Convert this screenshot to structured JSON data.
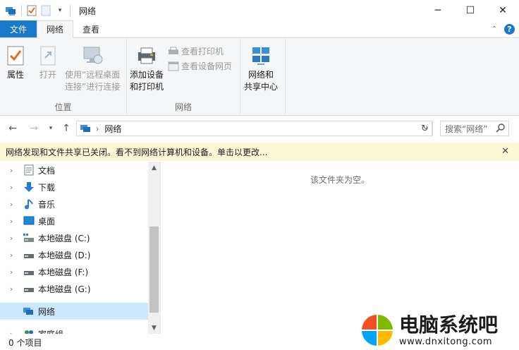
{
  "window": {
    "title": "网络",
    "minimize_icon": "─",
    "maximize_icon": "☐",
    "close_icon": "✕"
  },
  "ribbon_tabs": {
    "file": "文件",
    "network": "网络",
    "view": "查看"
  },
  "ribbon": {
    "location_group": {
      "label": "位置",
      "properties": "属性",
      "open": "打开",
      "remote_desktop_line1": "使用“远程桌面",
      "remote_desktop_line2": "连接”进行连接"
    },
    "network_group": {
      "label": "网络",
      "add_devices_line1": "添加设备",
      "add_devices_line2": "和打印机",
      "view_printers": "查看打印机",
      "view_device_webpage": "查看设备网页"
    },
    "sharing_group": {
      "network_sharing_line1": "网络和",
      "network_sharing_line2": "共享中心"
    }
  },
  "address": {
    "path": "网络",
    "search_placeholder": "搜索“网络”"
  },
  "infobar": {
    "message": "网络发现和文件共享已关闭。看不到网络计算机和设备。单击以更改...",
    "close": "✕"
  },
  "navigation": {
    "items": [
      {
        "label": "文档",
        "icon": "documents-icon"
      },
      {
        "label": "下载",
        "icon": "downloads-icon"
      },
      {
        "label": "音乐",
        "icon": "music-icon"
      },
      {
        "label": "桌面",
        "icon": "desktop-icon"
      },
      {
        "label": "本地磁盘 (C:)",
        "icon": "system-drive-icon"
      },
      {
        "label": "本地磁盘 (D:)",
        "icon": "drive-icon"
      },
      {
        "label": "本地磁盘 (F:)",
        "icon": "drive-icon"
      },
      {
        "label": "本地磁盘 (G:)",
        "icon": "drive-icon"
      }
    ],
    "network": "网络",
    "homegroup": "家庭组"
  },
  "content": {
    "empty_message": "该文件夹为空。"
  },
  "status": {
    "item_count": "0 个项目"
  },
  "watermark": {
    "brand": "电脑系统吧",
    "url": "www.dnxitong.com"
  },
  "colors": {
    "accent": "#1979ca",
    "infobar_bg": "#fcf7d7",
    "selected_bg": "#cce8ff"
  }
}
